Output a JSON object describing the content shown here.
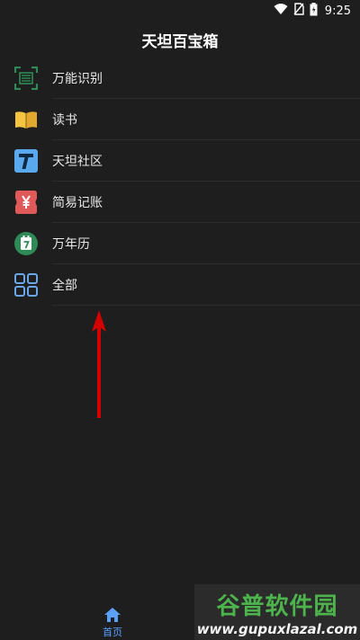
{
  "status": {
    "time": "9:25",
    "icons": [
      "wifi-icon",
      "no-sim-icon",
      "battery-icon"
    ]
  },
  "appbar": {
    "title": "天坦百宝箱"
  },
  "menu": [
    {
      "label": "万能识别",
      "icon": "scan-icon",
      "color": "#2e8b57"
    },
    {
      "label": "读书",
      "icon": "book-icon",
      "color": "#f5c542"
    },
    {
      "label": "天坦社区",
      "icon": "t-logo-icon",
      "color": "#5aa9ee"
    },
    {
      "label": "简易记账",
      "icon": "yuan-ticket-icon",
      "color": "#e05a5a"
    },
    {
      "label": "万年历",
      "icon": "calendar-icon",
      "color": "#2e8b57"
    },
    {
      "label": "全部",
      "icon": "grid-icon",
      "color": "#6aa6e8"
    }
  ],
  "bottom_nav": {
    "home_label": "首页",
    "active_color": "#5aa0ff"
  },
  "watermark": {
    "title": "谷普软件园",
    "url": "www.gupuxlazal.com"
  },
  "annotation": {
    "arrow_color": "#d40000"
  }
}
